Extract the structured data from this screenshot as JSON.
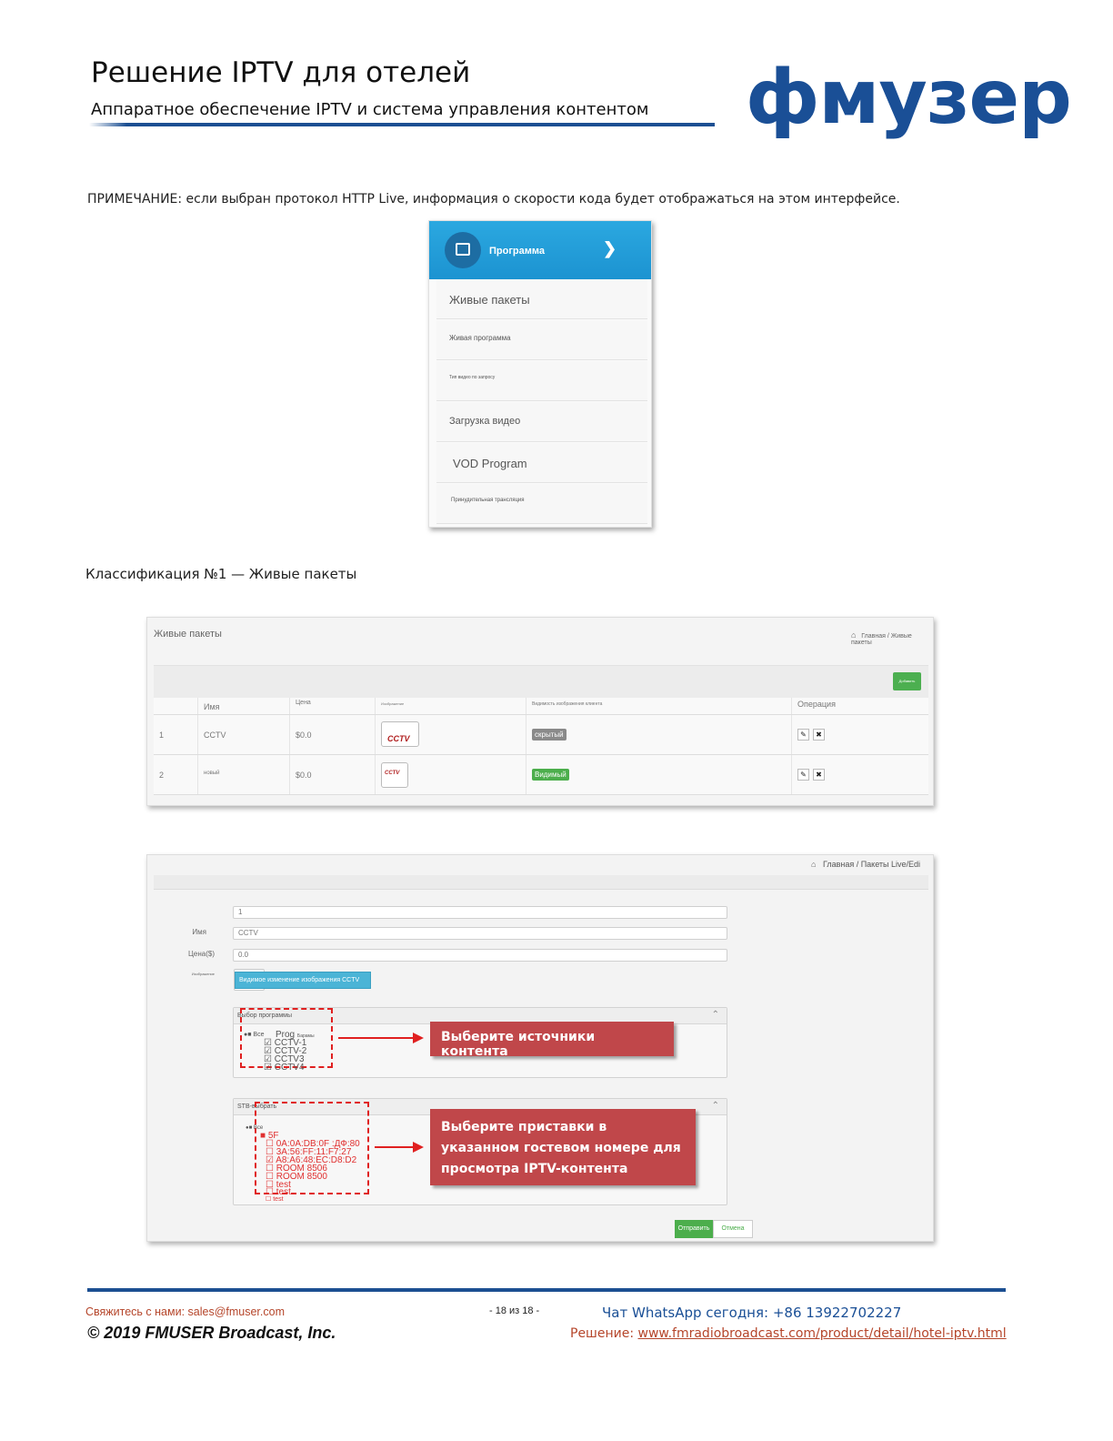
{
  "header": {
    "title": "Решение IPTV для отелей",
    "subtitle": "Аппаратное обеспечение IPTV и система управления контентом",
    "logo": "фмузер"
  },
  "note": "ПРИМЕЧАНИЕ: если выбран протокол HTTP Live, информация о скорости кода будет отображаться на этом интерфейсе.",
  "menu": {
    "header_label": "Программа",
    "items": [
      "Живые пакеты",
      "Живая программа",
      "Тип видео по запросу",
      "Загрузка видео",
      "VOD Program",
      "Принудительная трансляция"
    ]
  },
  "section_caption": "Классификация №1 — Живые пакеты",
  "live_packages": {
    "title": "Живые пакеты",
    "breadcrumb": "Главная / Живые пакеты",
    "add_button": "Добавить",
    "columns": [
      "Имя",
      "Цена",
      "Изображение",
      "Видимость изображения клиента",
      "Операция"
    ],
    "rows": [
      {
        "index": "1",
        "name": "CCTV",
        "price": "$0.0",
        "thumb": "CCTV",
        "visibility": "скрытый",
        "visibility_color": "#8a8a8a"
      },
      {
        "index": "2",
        "name": "новый",
        "price": "$0.0",
        "thumb": "CCTV",
        "visibility": "Видимый",
        "visibility_color": "#4cae4c"
      }
    ],
    "edit_icon": "pencil-icon",
    "delete_icon": "close-icon"
  },
  "edit_form": {
    "breadcrumb": "Главная / Пакеты Live/Edi",
    "fields": [
      {
        "label": "",
        "value": "1"
      },
      {
        "label": "Имя",
        "value": "CCTV"
      },
      {
        "label": "Цена($)",
        "value": "0.0"
      }
    ],
    "image_label": "Изображение",
    "image_button": "Видимое изменение изображения CCTV",
    "program_panel": {
      "title": "Выбор программы",
      "tree": [
        "Все",
        "Prog",
        "CCTV-1",
        "CCTV-2",
        "CCTV3",
        "CCTV4"
      ],
      "tree_suffix": "Барамы"
    },
    "stb_panel": {
      "title": "STB-выбрать",
      "tree_all": "Все",
      "tree_group": "5F",
      "tree_items": [
        "0A:0A:DB:0F :ДФ:80",
        "3A:56:FF:11:F7:27",
        "A8:A6:48:EC:D8:D2",
        "ROOM 8506",
        "ROOM 8500",
        "test",
        "test",
        "test"
      ]
    },
    "callout_content": "Выберите источники контента",
    "callout_stb": "Выберите приставки в указанном гостевом номере для просмотра IPTV-контента",
    "submit": "Отправить",
    "cancel": "Отмена"
  },
  "footer": {
    "contact": "Свяжитесь с нами: sales@fmuser.com",
    "page": "- 18 из 18 -",
    "whatsapp": "Чат WhatsApp сегодня: +86 13922702227",
    "copyright": "2019 FMUSER Broadcast, Inc.",
    "solution_label": "Решение: ",
    "solution_url": "www.fmradiobroadcast.com/product/detail/hotel-iptv.html"
  },
  "colors": {
    "brand_blue": "#1a4f96",
    "menu_blue": "#2ba8e0",
    "callout_red": "#c0474a",
    "footer_orange": "#b5452a"
  }
}
